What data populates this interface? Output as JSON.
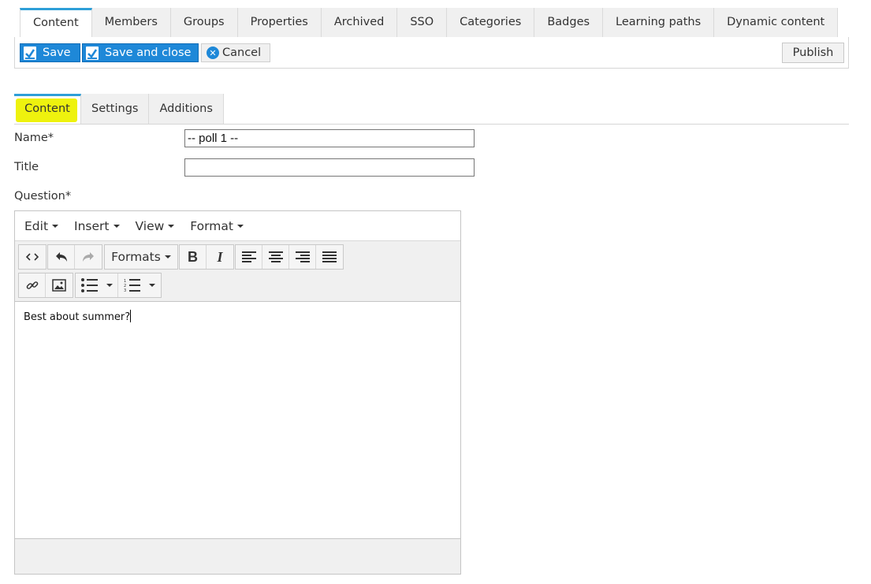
{
  "top_tabs": [
    {
      "label": "Content",
      "active": true
    },
    {
      "label": "Members",
      "active": false
    },
    {
      "label": "Groups",
      "active": false
    },
    {
      "label": "Properties",
      "active": false
    },
    {
      "label": "Archived",
      "active": false
    },
    {
      "label": "SSO",
      "active": false
    },
    {
      "label": "Categories",
      "active": false
    },
    {
      "label": "Badges",
      "active": false
    },
    {
      "label": "Learning paths",
      "active": false
    },
    {
      "label": "Dynamic content",
      "active": false
    }
  ],
  "toolbar": {
    "save_label": "Save",
    "save_close_label": "Save and close",
    "cancel_label": "Cancel",
    "publish_label": "Publish"
  },
  "sub_tabs": [
    {
      "label": "Content",
      "active": true
    },
    {
      "label": "Settings",
      "active": false
    },
    {
      "label": "Additions",
      "active": false
    }
  ],
  "form": {
    "name_label": "Name*",
    "name_value": "-- poll 1 --",
    "title_label": "Title",
    "title_value": "",
    "question_label": "Question*"
  },
  "editor": {
    "menu": [
      "Edit",
      "Insert",
      "View",
      "Format"
    ],
    "formats_label": "Formats",
    "content": "Best about summer?"
  },
  "colors": {
    "accent": "#1e88d8",
    "tab_indicator": "#2e9fd8",
    "highlight": "#eef20e"
  }
}
